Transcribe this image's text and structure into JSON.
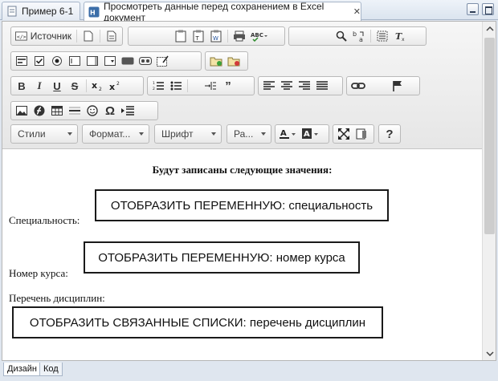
{
  "tabs": [
    {
      "label": "Пример 6-1"
    },
    {
      "label": "Просмотреть данные перед сохранением в Excel документ"
    }
  ],
  "toolbar": {
    "source_label": "Источник",
    "styles_label": "Стили",
    "format_label": "Формат...",
    "font_label": "Шрифт",
    "size_label": "Ра...",
    "help_label": "?"
  },
  "content": {
    "heading": "Будут записаны следующие значения:",
    "specialty_label": "Специальность:",
    "specialty_value": "ОТОБРАЗИТЬ ПЕРЕМЕННУЮ: специальность",
    "course_label": "Номер курса:",
    "course_value": "ОТОБРАЗИТЬ ПЕРЕМЕННУЮ: номер курса",
    "disciplines_label": "Перечень дисциплин:",
    "disciplines_value": "ОТОБРАЗИТЬ СВЯЗАННЫЕ СПИСКИ: перечень дисциплин"
  },
  "bottom_tabs": [
    {
      "label": "Дизайн"
    },
    {
      "label": "Код"
    }
  ]
}
